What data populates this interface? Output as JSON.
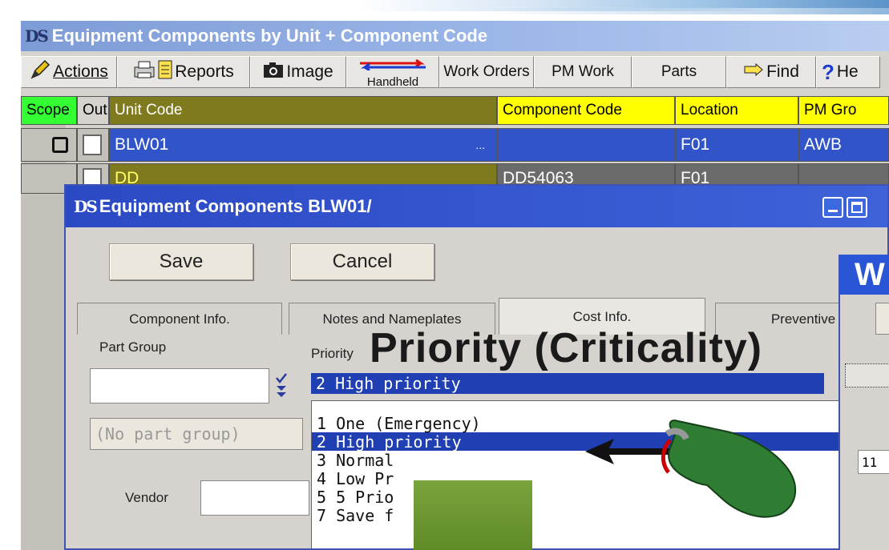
{
  "main_window": {
    "logo": "DS",
    "title": "Equipment Components by Unit + Component Code"
  },
  "toolbar": {
    "actions": "Actions",
    "reports": "Reports",
    "image": "Image",
    "handheld": "Handheld",
    "work_orders": "Work Orders",
    "pm_work": "PM Work",
    "parts": "Parts",
    "find": "Find",
    "help": "He"
  },
  "grid": {
    "headers": [
      "Scope",
      "Out",
      "Unit Code",
      "Component Code",
      "Location",
      "PM Gro"
    ],
    "rows": [
      {
        "unit_code": "BLW01",
        "ellipsis": "...",
        "component_code": "",
        "location": "F01",
        "pm_group": "AWB"
      },
      {
        "unit_code": "DD",
        "component_code": "DD54063",
        "location": "F01",
        "pm_group": ""
      }
    ]
  },
  "dialog": {
    "logo": "DS",
    "title": "Equipment Components BLW01/",
    "save": "Save",
    "cancel": "Cancel",
    "tabs": [
      "Component Info.",
      "Notes and Nameplates",
      "Cost Info.",
      "Preventive"
    ],
    "part_group_label": "Part Group",
    "part_group_value": "",
    "part_group_placeholder": "(No part group)",
    "priority_label": "Priority",
    "priority_selected": "2 High priority",
    "priority_options": [
      "1 One (Emergency)",
      "2 High priority",
      "3 Normal",
      "4 Low Pr",
      "5 5 Prio",
      "7 Save f"
    ],
    "vendor_label": "Vendor"
  },
  "overlay": {
    "heading": "Priority  (Criticality)"
  },
  "side_window": {
    "title": "W",
    "field_value": "11"
  },
  "colors": {
    "scope_header": "#33ff33",
    "yellow_header": "#ffff00",
    "olive_header": "#807a1f",
    "selection_blue": "#1f3fb3"
  }
}
